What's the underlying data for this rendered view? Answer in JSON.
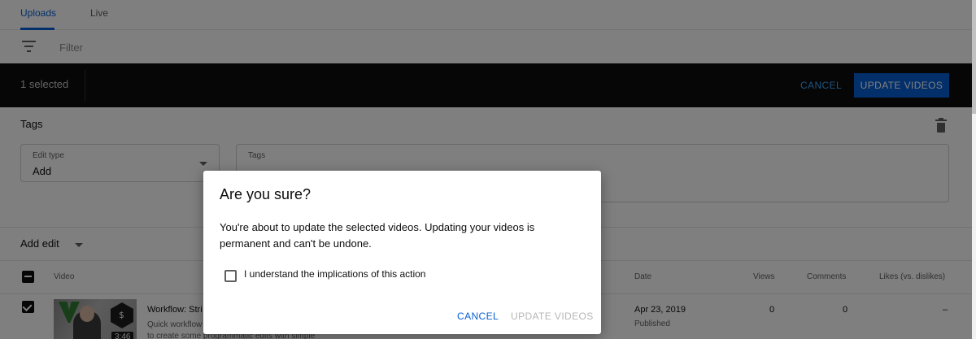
{
  "tabs": [
    {
      "label": "Uploads",
      "active": true
    },
    {
      "label": "Live",
      "active": false
    }
  ],
  "filter": {
    "placeholder": "Filter",
    "icon": "filter-icon"
  },
  "selection_bar": {
    "count_text": "1 selected",
    "cancel_label": "CANCEL",
    "update_label": "UPDATE VIDEOS"
  },
  "edit_panel": {
    "title": "Tags",
    "delete_icon": "trash-icon",
    "edit_type": {
      "label": "Edit type",
      "value": "Add"
    },
    "tags_field": {
      "label": "Tags",
      "value": ""
    },
    "add_edit_label": "Add edit"
  },
  "table": {
    "headers": {
      "video": "Video",
      "date": "Date",
      "views": "Views",
      "comments": "Comments",
      "likes": "Likes (vs. dislikes)"
    },
    "rows": [
      {
        "selected": true,
        "duration": "3:46",
        "title": "Workflow: Stri",
        "description": "Quick workflow\nto create some programmatic edits with simple",
        "date": "Apr 23, 2019",
        "status": "Published",
        "views": "0",
        "comments": "0",
        "likes": "–"
      }
    ]
  },
  "dialog": {
    "title": "Are you sure?",
    "body": "You're about to update the selected videos. Updating your videos is permanent and can't be undone.",
    "checkbox_label": "I understand the implications of this action",
    "checkbox_checked": false,
    "cancel_label": "CANCEL",
    "update_label": "UPDATE VIDEOS",
    "update_enabled": false
  },
  "colors": {
    "accent": "#065fd4",
    "selection_bar_bg": "#0d0d0d",
    "selection_cancel": "#3ea6ff",
    "disabled_text": "#b5b5b5"
  }
}
